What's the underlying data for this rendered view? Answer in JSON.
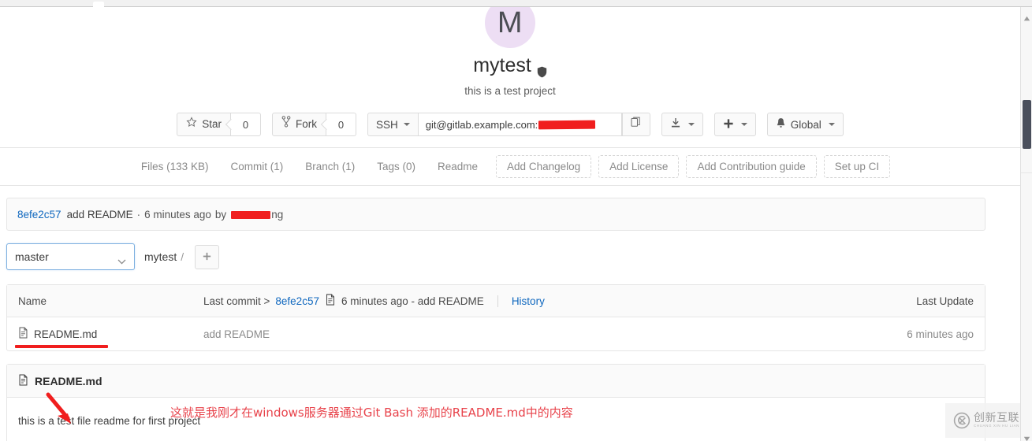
{
  "project": {
    "avatar_initial": "M",
    "name": "mytest",
    "visibility_icon": "shield-icon",
    "description": "this is a test project"
  },
  "actions": {
    "star_label": "Star",
    "star_count": "0",
    "star_icon": "star-icon",
    "fork_label": "Fork",
    "fork_count": "0",
    "fork_icon": "fork-icon",
    "clone_protocol": "SSH",
    "clone_url_visible": "git@gitlab.example.com:",
    "copy_icon": "copy-icon",
    "download_icon": "download-icon",
    "plus_icon": "plus-icon",
    "notification_icon": "bell-icon",
    "notification_label": "Global"
  },
  "nav": {
    "links": [
      {
        "label": "Files (133 KB)",
        "name": "nav-files"
      },
      {
        "label": "Commit (1)",
        "name": "nav-commit"
      },
      {
        "label": "Branch (1)",
        "name": "nav-branch"
      },
      {
        "label": "Tags (0)",
        "name": "nav-tags"
      },
      {
        "label": "Readme",
        "name": "nav-readme"
      }
    ],
    "dashed_buttons": [
      {
        "label": "Add Changelog",
        "name": "add-changelog-button"
      },
      {
        "label": "Add License",
        "name": "add-license-button"
      },
      {
        "label": "Add Contribution guide",
        "name": "add-contribution-guide-button"
      },
      {
        "label": "Set up CI",
        "name": "set-up-ci-button"
      }
    ]
  },
  "commit_banner": {
    "sha": "8efe2c57",
    "message": "add README",
    "separator": "·",
    "time": "6 minutes ago",
    "by_label": "by",
    "author_suffix": "ng"
  },
  "branch_bar": {
    "selected_branch": "master",
    "breadcrumb_project": "mytest",
    "breadcrumb_separator": "/",
    "add_icon": "plus-icon"
  },
  "file_table": {
    "header": {
      "name_col": "Name",
      "last_commit_label": "Last commit >",
      "last_commit_sha": "8efe2c57",
      "commit_icon": "commit-file-icon",
      "last_commit_text": "6 minutes ago - add README",
      "history_link": "History",
      "last_update_col": "Last Update"
    },
    "rows": [
      {
        "icon": "file-icon",
        "name": "README.md",
        "commit_message": "add README",
        "last_update": "6 minutes ago"
      }
    ]
  },
  "readme": {
    "icon": "file-icon",
    "title": "README.md",
    "body": "this is a test file readme for first project"
  },
  "annotations": {
    "arrow": "red-arrow",
    "text": "这就是我刚才在windows服务器通过Git Bash 添加的README.md中的内容",
    "color": "#e8434b"
  },
  "watermark": {
    "logo": "cx-logo-icon",
    "text_cn": "创新互联",
    "text_en": "CHUANG XIN HU LIAN"
  }
}
